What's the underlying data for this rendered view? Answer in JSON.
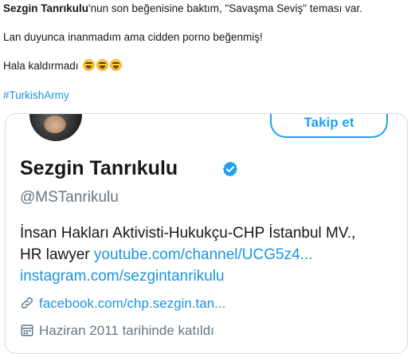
{
  "tweet": {
    "author_mention": "Sezgin Tanrıkulu",
    "line1_rest": "'nun son beğenisine baktım, \"Savaşma Seviş\" teması var.",
    "line2": "Lan duyunca inanmadım ama cidden porno beğenmiş!",
    "line3": "Hala kaldırmadı",
    "emoji_name": "face-with-tears-of-joy-icon",
    "emoji_count": 3,
    "hashtag": "#TurkishArmy"
  },
  "profile_card": {
    "follow_button_label": "Takip et",
    "display_name": "Sezgin Tanrıkulu",
    "verified": true,
    "handle": "@MSTanrikulu",
    "bio_line1": "İnsan Hakları Aktivisti-Hukukçu-CHP İstanbul MV.,",
    "bio_line2_text": "HR lawyer ",
    "bio_line2_link": "youtube.com/channel/UCG5z4...",
    "bio_line3_link": "instagram.com/sezgintanrikulu",
    "website_link": "facebook.com/chp.sezgin.tan...",
    "joined_text": "Haziran 2011 tarihinde katıldı"
  },
  "colors": {
    "link_blue": "#1b95e0",
    "follow_blue": "#1da1f2",
    "muted_gray": "#657786",
    "text": "#14171a",
    "card_border": "#d7dde2"
  }
}
